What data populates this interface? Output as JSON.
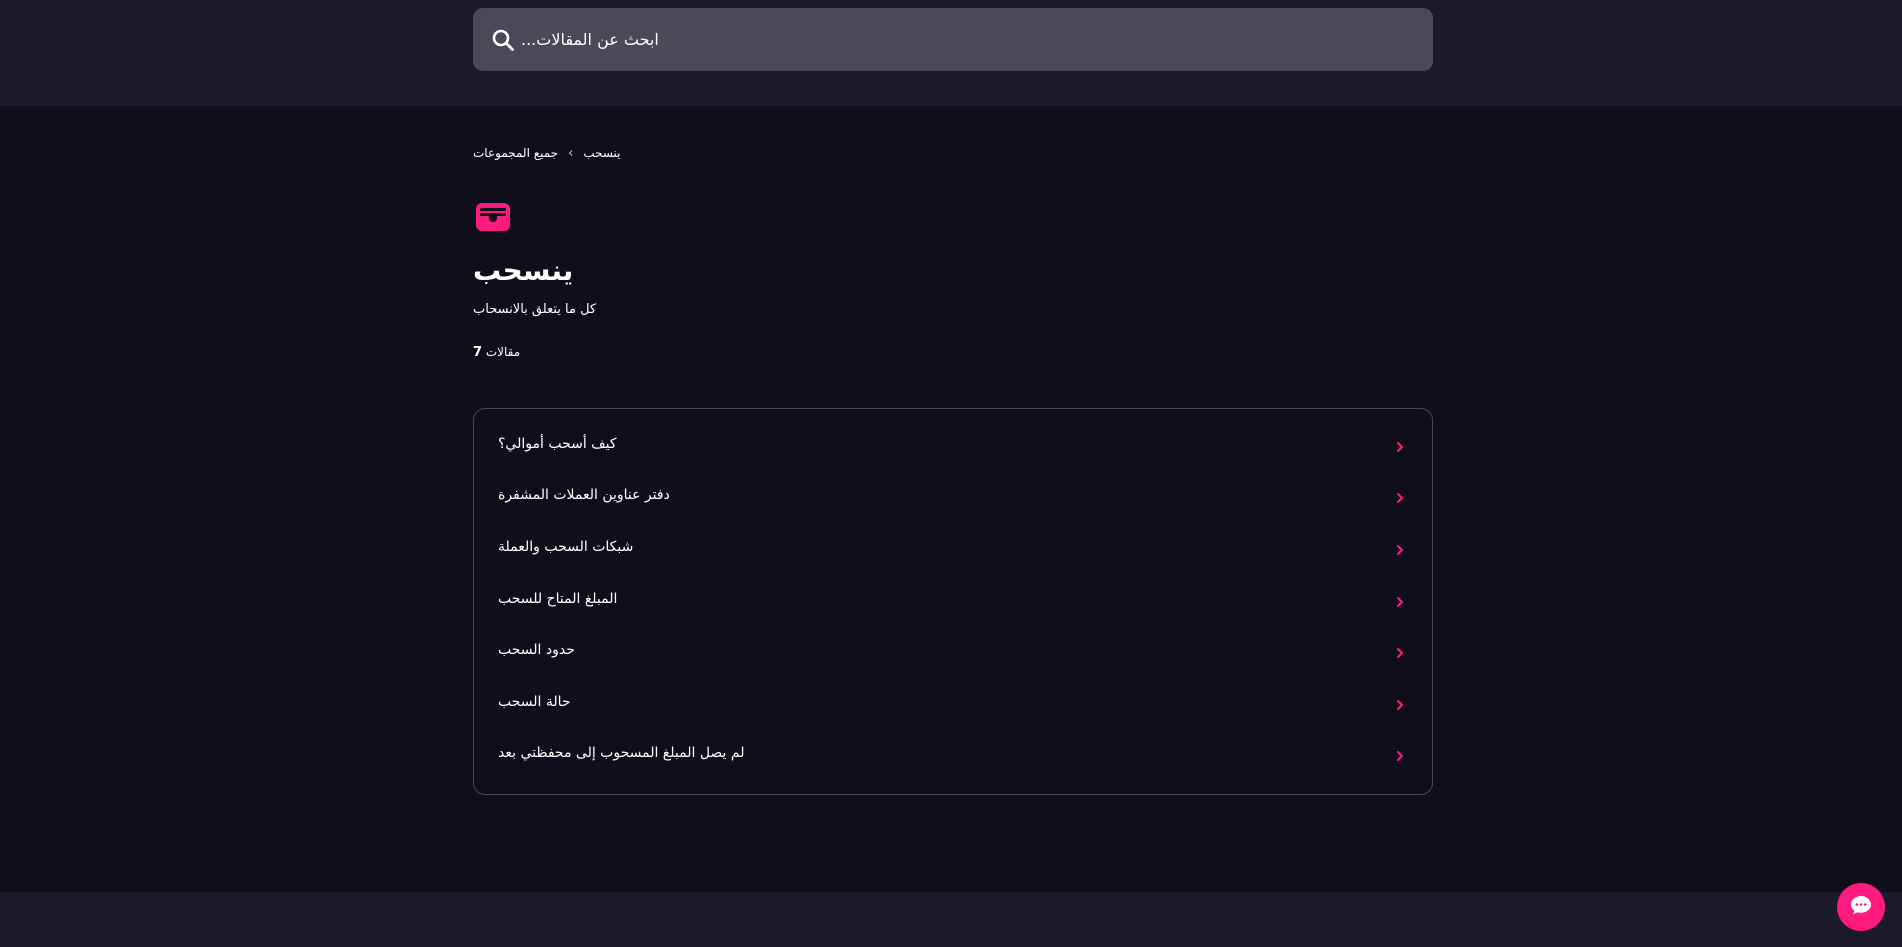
{
  "colors": {
    "accent": "#ff1a7f",
    "page_background": "#100e1a",
    "band_background": "#1c1a28",
    "search_background": "#4b4858"
  },
  "search": {
    "placeholder": "ابحث عن المقالات...",
    "icon": "search-icon"
  },
  "breadcrumb": {
    "items": [
      {
        "label": "جميع المجموعات"
      },
      {
        "label": "ينسحب"
      }
    ],
    "separator_icon": "chevron-left-icon"
  },
  "collection": {
    "icon": "wallet-icon",
    "title": "ينسحب",
    "description": "كل ما يتعلق بالانسحاب",
    "article_count": "7",
    "article_count_label": "مقالات"
  },
  "articles": [
    {
      "title": "كيف أسحب أموالي؟"
    },
    {
      "title": "دفتر عناوين العملات المشفرة"
    },
    {
      "title": "شبكات السحب والعملة"
    },
    {
      "title": "المبلغ المتاح للسحب"
    },
    {
      "title": "حدود السحب"
    },
    {
      "title": "حالة السحب"
    },
    {
      "title": "لم يصل المبلغ المسحوب إلى محفظتي بعد"
    }
  ],
  "chat": {
    "icon": "chat-bubble-icon"
  }
}
